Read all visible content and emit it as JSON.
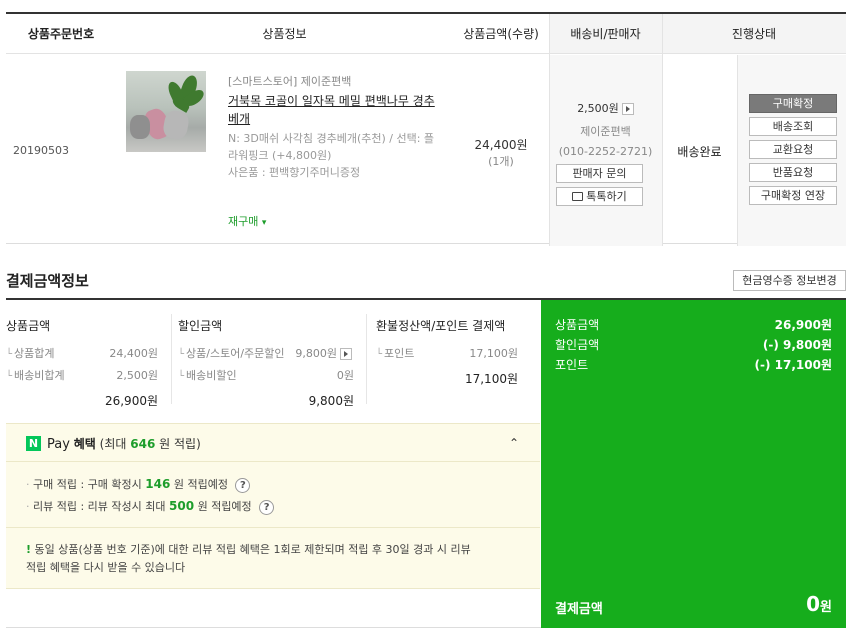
{
  "order": {
    "headers": {
      "order_no": "상품주문번호",
      "product_info": "상품정보",
      "amount_qty": "상품금액(수량)",
      "shipping_seller": "배송비/판매자",
      "status": "진행상태"
    },
    "order_no": "20190503",
    "store": "[스마트스토어] 제이준편백",
    "product_name_line1": "거북목 코골이 일자목 메밀 편백나무 경추",
    "product_name_line2": "베개",
    "option_line1": "N: 3D매쉬 사각침 경추베개(추천) / 선택: 플",
    "option_line2": "라워핑크 (+4,800원)",
    "gift": "사은품 : 편백향기주머니증정",
    "reorder": "재구매",
    "price": "24,400원",
    "qty": "(1개)",
    "shipping_fee": "2,500원",
    "seller_name": "제이준편백",
    "seller_phone": "(010-2252-2721)",
    "seller_inquiry": "판매자 문의",
    "talk": "톡톡하기",
    "delivery_status": "배송완료",
    "actions": [
      "구매확정",
      "배송조회",
      "교환요청",
      "반품요청",
      "구매확정 연장"
    ]
  },
  "payment": {
    "title": "결제금액정보",
    "receipt_button": "현금영수증 정보변경",
    "product_amount": {
      "header": "상품금액",
      "rows": [
        {
          "label": "상품합계",
          "value": "24,400원"
        },
        {
          "label": "배송비합계",
          "value": "2,500원"
        }
      ],
      "sum": "26,900원"
    },
    "discount": {
      "header": "할인금액",
      "rows": [
        {
          "label": "상품/스토어/주문할인",
          "value": "9,800원"
        },
        {
          "label": "배송비할인",
          "value": "0원"
        }
      ],
      "sum": "9,800원"
    },
    "refund_point": {
      "header": "환불정산액/포인트 결제액",
      "rows": [
        {
          "label": "포인트",
          "value": "17,100원"
        }
      ],
      "sum": "17,100원"
    },
    "npay": {
      "logo": "N",
      "pay": "Pay",
      "benefit": "혜택",
      "max_prefix": "(최대",
      "max_points": "646",
      "max_suffix": "원 적립)",
      "purchase_prefix": "구매 적립 : 구매 확정시",
      "purchase_points": "146",
      "purchase_suffix": "원 적립예정",
      "review_prefix": "리뷰 적립 : 리뷰 작성시 최대",
      "review_points": "500",
      "review_suffix": "원 적립예정",
      "notice_mark": "!",
      "notice_line1": "동일 상품(상품 번호 기준)에 대한 리뷰 적립 혜택은 1회로 제한되며 적립 후 30일 경과 시 리뷰",
      "notice_line2": "적립 혜택을 다시 받을 수 있습니다",
      "question": "?"
    },
    "summary": {
      "rows": [
        {
          "label": "상품금액",
          "value": "26,900원"
        },
        {
          "label": "할인금액",
          "value": "(-) 9,800원"
        },
        {
          "label": "포인트",
          "value": "(-) 17,100원"
        }
      ],
      "total_label": "결제금액",
      "total_value": "0",
      "total_unit": "원"
    }
  }
}
